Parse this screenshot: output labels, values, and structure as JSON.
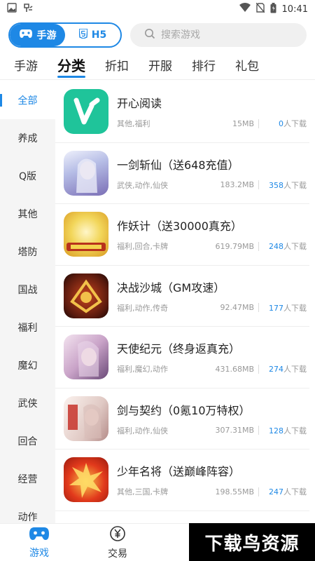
{
  "status_bar": {
    "time": "10:41"
  },
  "top_bar": {
    "segments": [
      {
        "label": "手游",
        "icon": "gamepad-icon",
        "active": true
      },
      {
        "label": "H5",
        "icon": "html5-icon",
        "active": false
      }
    ],
    "search": {
      "placeholder": "搜索游戏"
    }
  },
  "top_tabs": [
    {
      "label": "手游",
      "active": false
    },
    {
      "label": "分类",
      "active": true
    },
    {
      "label": "折扣",
      "active": false
    },
    {
      "label": "开服",
      "active": false
    },
    {
      "label": "排行",
      "active": false
    },
    {
      "label": "礼包",
      "active": false
    }
  ],
  "categories": [
    "全部",
    "养成",
    "Q版",
    "其他",
    "塔防",
    "国战",
    "福利",
    "魔幻",
    "武侠",
    "回合",
    "经营",
    "动作"
  ],
  "games": [
    {
      "title": "开心阅读",
      "tags": "其他,福利",
      "size": "15MB",
      "downloads": "0",
      "dl_suffix": "人下载",
      "color": "#1fc49a"
    },
    {
      "title": "一剑斩仙（送648充值）",
      "tags": "武侠,动作,仙侠",
      "size": "183.2MB",
      "downloads": "358",
      "dl_suffix": "人下载",
      "color": "#9aa8d8"
    },
    {
      "title": "作妖计（送30000真充）",
      "tags": "福利,回合,卡牌",
      "size": "619.79MB",
      "downloads": "248",
      "dl_suffix": "人下载",
      "color": "#e8c23a"
    },
    {
      "title": "决战沙城（GM攻速）",
      "tags": "福利,动作,传奇",
      "size": "92.47MB",
      "downloads": "177",
      "dl_suffix": "人下载",
      "color": "#7a2a1a"
    },
    {
      "title": "天使纪元（终身返真充）",
      "tags": "福利,魔幻,动作",
      "size": "431.68MB",
      "downloads": "274",
      "dl_suffix": "人下载",
      "color": "#c9a3c8"
    },
    {
      "title": "剑与契约（0氪10万特权）",
      "tags": "福利,动作,仙侠",
      "size": "307.31MB",
      "downloads": "128",
      "dl_suffix": "人下载",
      "color": "#e0c9c4"
    },
    {
      "title": "少年名将（送巅峰阵容）",
      "tags": "其他,三国,卡牌",
      "size": "198.55MB",
      "downloads": "247",
      "dl_suffix": "人下载",
      "color": "#e23a1c"
    }
  ],
  "bottom_nav": [
    {
      "label": "游戏",
      "icon": "gamepad-icon",
      "active": true
    },
    {
      "label": "交易",
      "icon": "yen-icon",
      "active": false
    }
  ],
  "watermark": "下载鸟资源"
}
